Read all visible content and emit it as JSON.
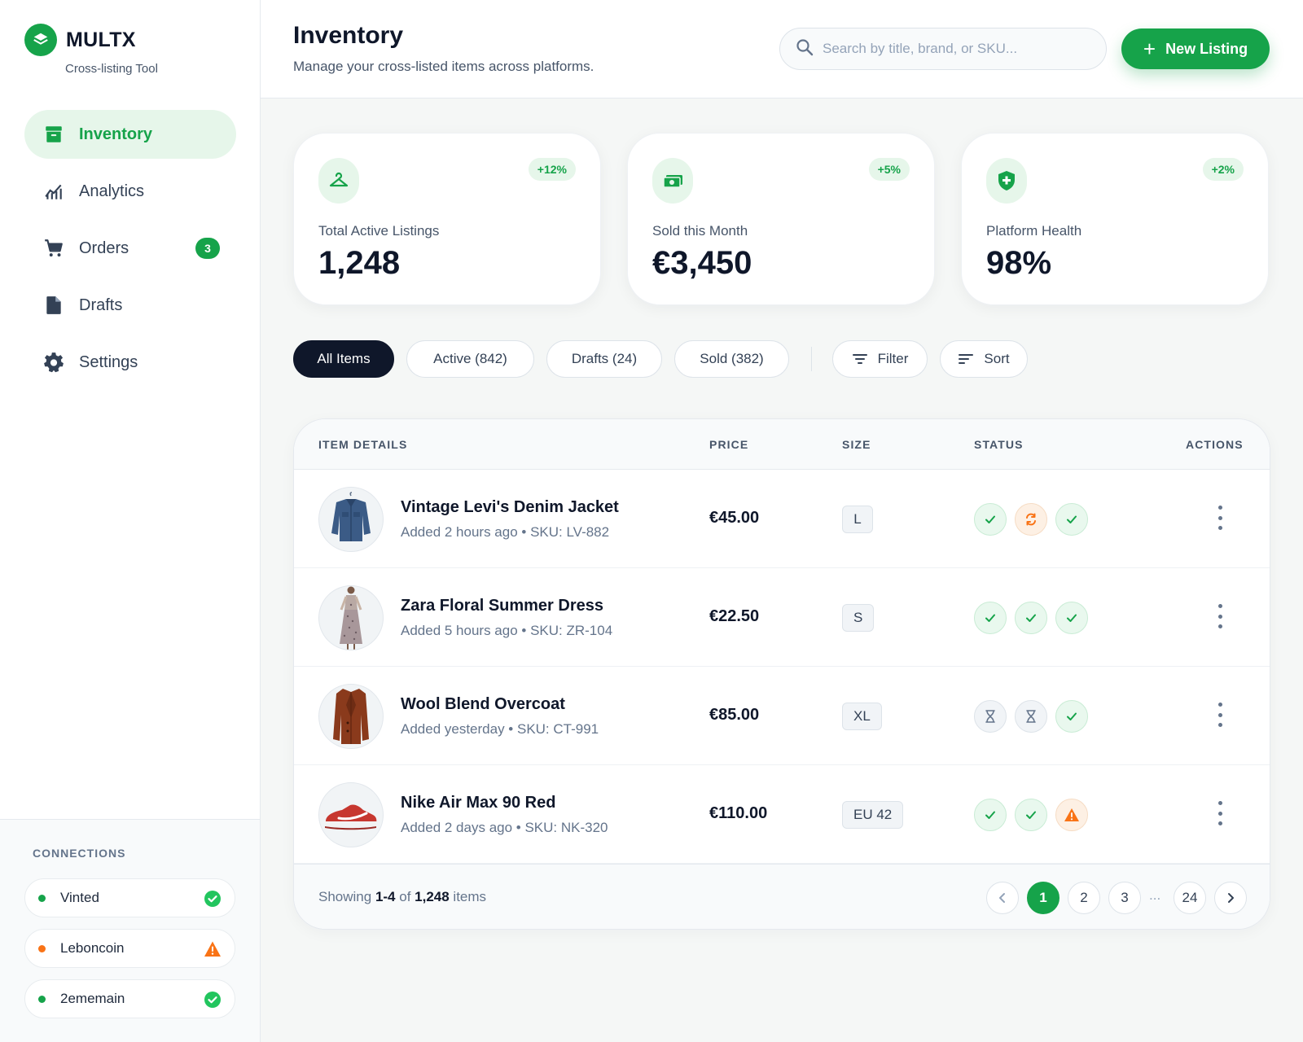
{
  "brand": {
    "name": "MULTX",
    "subtitle": "Cross-listing Tool"
  },
  "nav": [
    {
      "label": "Inventory",
      "icon": "archive-icon",
      "active": true
    },
    {
      "label": "Analytics",
      "icon": "analytics-icon"
    },
    {
      "label": "Orders",
      "icon": "cart-icon",
      "badge": "3"
    },
    {
      "label": "Drafts",
      "icon": "document-icon"
    },
    {
      "label": "Settings",
      "icon": "gear-icon"
    }
  ],
  "connections": {
    "title": "CONNECTIONS",
    "items": [
      {
        "name": "Vinted",
        "dot": "#16a34a",
        "status": "check-icon"
      },
      {
        "name": "Leboncoin",
        "dot": "#f97316",
        "status": "warning-icon"
      },
      {
        "name": "2ememain",
        "dot": "#16a34a",
        "status": "check-icon"
      }
    ]
  },
  "header": {
    "title": "Inventory",
    "subtitle": "Manage your cross-listed items across platforms.",
    "search_placeholder": "Search by title, brand, or SKU...",
    "new_button": "New Listing"
  },
  "stats": [
    {
      "label": "Total Active Listings",
      "value": "1,248",
      "delta": "+12%",
      "icon": "hanger-icon"
    },
    {
      "label": "Sold this Month",
      "value": "€3,450",
      "delta": "+5%",
      "icon": "cash-icon"
    },
    {
      "label": "Platform Health",
      "value": "98%",
      "delta": "+2%",
      "icon": "shield-icon"
    }
  ],
  "filters": {
    "tabs": [
      "All Items",
      "Active (842)",
      "Drafts (24)",
      "Sold (382)"
    ],
    "filter_label": "Filter",
    "sort_label": "Sort"
  },
  "table": {
    "columns": [
      "ITEM DETAILS",
      "PRICE",
      "SIZE",
      "STATUS",
      "ACTIONS"
    ],
    "rows": [
      {
        "title": "Vintage Levi's Denim Jacket",
        "meta": "Added 2 hours ago • SKU: LV-882",
        "price": "€45.00",
        "size": "L",
        "statuses": [
          "ok",
          "sync",
          "ok"
        ],
        "thumb": "denim-jacket"
      },
      {
        "title": "Zara Floral Summer Dress",
        "meta": "Added 5 hours ago • SKU: ZR-104",
        "price": "€22.50",
        "size": "S",
        "statuses": [
          "ok",
          "ok",
          "ok"
        ],
        "thumb": "dress"
      },
      {
        "title": "Wool Blend Overcoat",
        "meta": "Added yesterday • SKU: CT-991",
        "price": "€85.00",
        "size": "XL",
        "statuses": [
          "wait",
          "wait",
          "ok"
        ],
        "thumb": "overcoat"
      },
      {
        "title": "Nike Air Max 90 Red",
        "meta": "Added 2 days ago • SKU: NK-320",
        "price": "€110.00",
        "size": "EU 42",
        "statuses": [
          "ok",
          "ok",
          "warn"
        ],
        "thumb": "sneaker"
      }
    ],
    "footer": {
      "prefix": "Showing ",
      "range": "1-4",
      "middle": " of ",
      "total": "1,248",
      "suffix": " items"
    },
    "pages": [
      "1",
      "2",
      "3",
      "24"
    ],
    "ellipsis": "..."
  },
  "colors": {
    "accent": "#16a34a",
    "warning": "#f97316",
    "dark": "#0f172a"
  }
}
